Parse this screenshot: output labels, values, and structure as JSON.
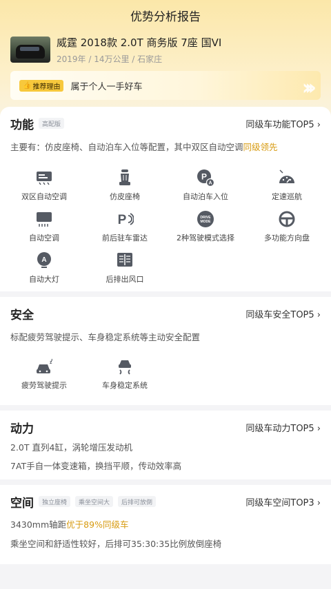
{
  "header": {
    "title": "优势分析报告"
  },
  "car": {
    "name": "威霆 2018款 2.0T 商务版 7座 国VI",
    "meta": "2019年 / 14万公里 / 石家庄"
  },
  "reason": {
    "tag": "推荐理由",
    "text": "属于个人一手好车"
  },
  "function": {
    "title": "功能",
    "chip": "高配版",
    "top5": "同级车功能TOP5 ›",
    "desc_prefix": "主要有：仿皮座椅、自动泊车入位等配置，其中双区自动空调",
    "desc_highlight": "同级领先",
    "features": [
      {
        "label": "双区自动空调",
        "icon": "dual-zone-ac-icon"
      },
      {
        "label": "仿皮座椅",
        "icon": "leather-seat-icon"
      },
      {
        "label": "自动泊车入位",
        "icon": "auto-parking-icon"
      },
      {
        "label": "定速巡航",
        "icon": "cruise-control-icon"
      },
      {
        "label": "自动空调",
        "icon": "auto-ac-icon"
      },
      {
        "label": "前后驻车雷达",
        "icon": "parking-radar-icon"
      },
      {
        "label": "2种驾驶模式选择",
        "icon": "drive-mode-icon"
      },
      {
        "label": "多功能方向盘",
        "icon": "steering-wheel-icon"
      },
      {
        "label": "自动大灯",
        "icon": "auto-headlight-icon"
      },
      {
        "label": "后排出风口",
        "icon": "rear-vent-icon"
      }
    ],
    "drive_mode_text": "DRIVE MODE"
  },
  "safety": {
    "title": "安全",
    "top5": "同级车安全TOP5 ›",
    "desc": "标配疲劳驾驶提示、车身稳定系统等主动安全配置",
    "features": [
      {
        "label": "疲劳驾驶提示",
        "icon": "fatigue-alert-icon"
      },
      {
        "label": "车身稳定系统",
        "icon": "stability-control-icon"
      }
    ]
  },
  "power": {
    "title": "动力",
    "top5": "同级车动力TOP5 ›",
    "line1": "2.0T 直列4缸，涡轮增压发动机",
    "line2": "7AT手自一体变速箱，换挡平顺，传动效率高"
  },
  "space": {
    "title": "空间",
    "chips": [
      "独立座椅",
      "乘坐空间大",
      "后排可放倒"
    ],
    "top5": "同级车空间TOP3 ›",
    "line1_prefix": "3430mm轴距",
    "line1_highlight": "优于89%同级车",
    "line2": "乘坐空间和舒适性较好，后排可35:30:35比例放倒座椅"
  },
  "colors": {
    "accent": "#d79a0f",
    "tag_bg": "#f7c83c",
    "icon": "#555a63"
  }
}
